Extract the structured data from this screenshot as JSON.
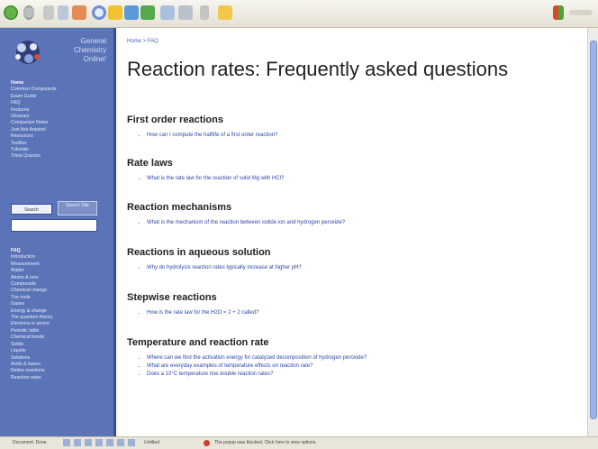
{
  "sidebar": {
    "site_name": "General Chemistry Online!",
    "primary_nav": [
      "Home",
      "Common Compounds",
      "Exam Guide",
      "FAQ",
      "Features",
      "Glossary",
      "Companion Notes",
      "Just Ask Antoine!",
      "Resources",
      "Toolbox",
      "Tutorials",
      "Trivia Quizzes"
    ],
    "search": {
      "select_label": "Search",
      "go_label": "Search Site",
      "input_value": ""
    },
    "faq_nav": [
      "FAQ",
      "Introduction",
      "Measurement",
      "Matter",
      "Atoms & ions",
      "Compounds",
      "Chemical change",
      "The mole",
      "Gases",
      "Energy & change",
      "The quantum theory",
      "Electrons in atoms",
      "Periodic table",
      "Chemical bonds",
      "Solids",
      "Liquids",
      "Solutions",
      "Acids & bases",
      "Redox reactions",
      "Reaction rates"
    ]
  },
  "main": {
    "breadcrumb": "Home > FAQ",
    "title": "Reaction rates: Frequently asked questions",
    "sections": [
      {
        "heading": "First order reactions",
        "links": [
          "How can I compute the halflife of a first order reaction?"
        ]
      },
      {
        "heading": "Rate laws",
        "links": [
          "What is the rate law for the reaction of solid Mg with HCl?"
        ]
      },
      {
        "heading": "Reaction mechanisms",
        "links": [
          "What is the mechanism of the reaction between iodide ion and hydrogen peroxide?"
        ]
      },
      {
        "heading": "Reactions in aqueous solution",
        "links": [
          "Why do hydrolysis reaction rates typically increase at higher pH?"
        ]
      },
      {
        "heading": "Stepwise reactions",
        "links": [
          "How is the rate law for the H2O = 2 + 2 called?"
        ]
      },
      {
        "heading": "Temperature and reaction rate",
        "links": [
          "Where can we find the activation energy for catalyzed decomposition of hydrogen peroxide?",
          "What are everyday examples of temperature effects on reaction rate?",
          "Does a 10°C temperature rise double reaction rates?"
        ]
      }
    ]
  },
  "statusbar": {
    "start": "Document: Done",
    "tab": "Untitled",
    "message": "The popup was blocked. Click here to view options."
  },
  "colors": {
    "sidebar": "#5b74b8",
    "link": "#2d47a6",
    "scroll_thumb": "#9eb3e6"
  },
  "icons": [
    "back-icon",
    "forward-icon",
    "stop-icon",
    "refresh-icon",
    "home-icon",
    "search-icon",
    "favorites-icon",
    "media-icon",
    "history-icon",
    "mail-icon",
    "print-icon",
    "edit-icon",
    "folder-icon",
    "windows-logo-icon"
  ]
}
